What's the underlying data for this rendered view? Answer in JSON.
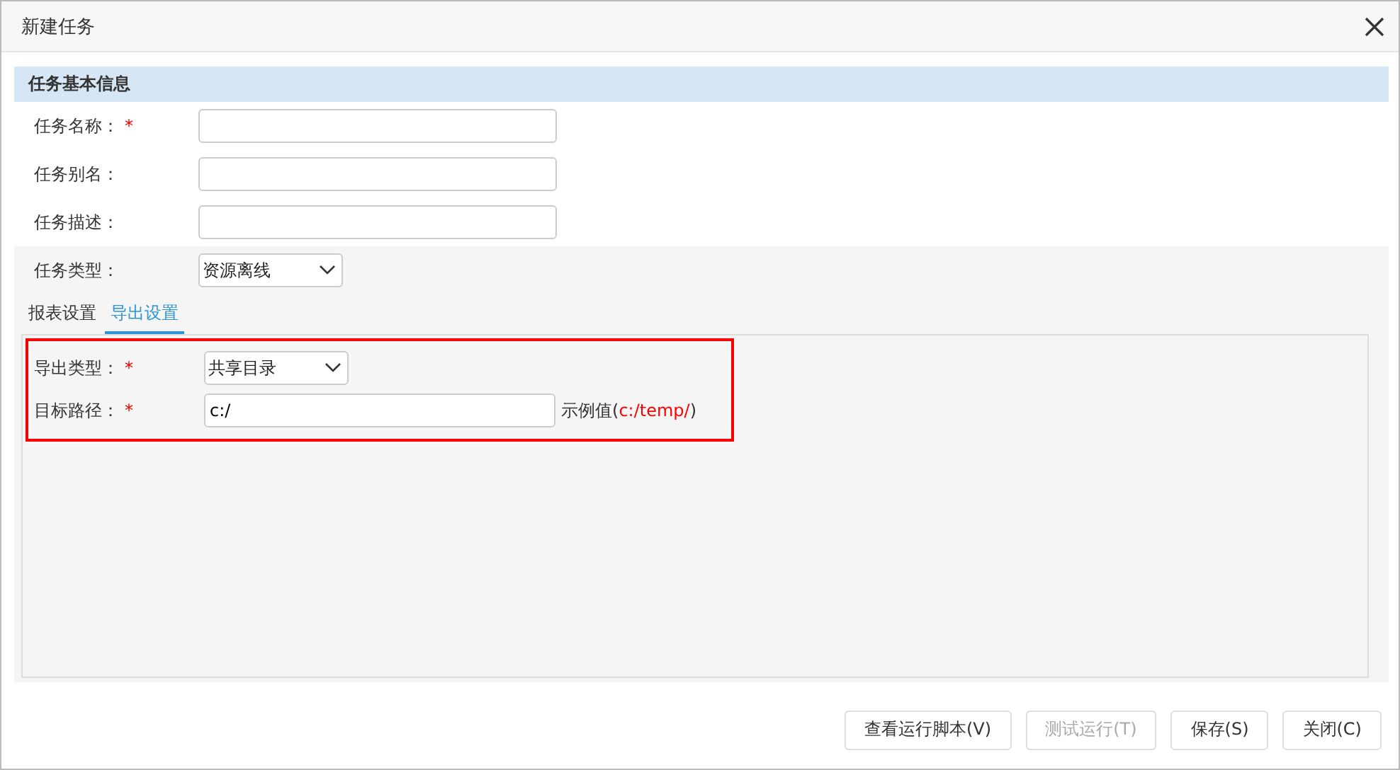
{
  "window": {
    "title": "新建任务"
  },
  "section": {
    "title": "任务基本信息"
  },
  "fields": [
    {
      "label": "任务名称：",
      "required_mark": "*"
    },
    {
      "label": "任务别名："
    },
    {
      "label": "任务描述："
    }
  ],
  "task_type": {
    "label": "任务类型：",
    "value": "资源离线"
  },
  "tabs": [
    {
      "label": "报表设置",
      "selected": false
    },
    {
      "label": "导出设置",
      "selected": true
    }
  ],
  "export": {
    "type": {
      "label": "导出类型：",
      "required_mark": "*",
      "value": "共享目录"
    },
    "path": {
      "label": "目标路径：",
      "required_mark": "*",
      "value": "c:/"
    },
    "hint": {
      "prefix": "示例值(",
      "example": "c:/temp/",
      "suffix": ")"
    }
  },
  "buttons": [
    {
      "label": "查看运行脚本(V)",
      "disabled": false
    },
    {
      "label": "测试运行(T)",
      "disabled": true
    },
    {
      "label": "保存(S)",
      "disabled": false
    },
    {
      "label": "关闭(C)",
      "disabled": false
    }
  ]
}
